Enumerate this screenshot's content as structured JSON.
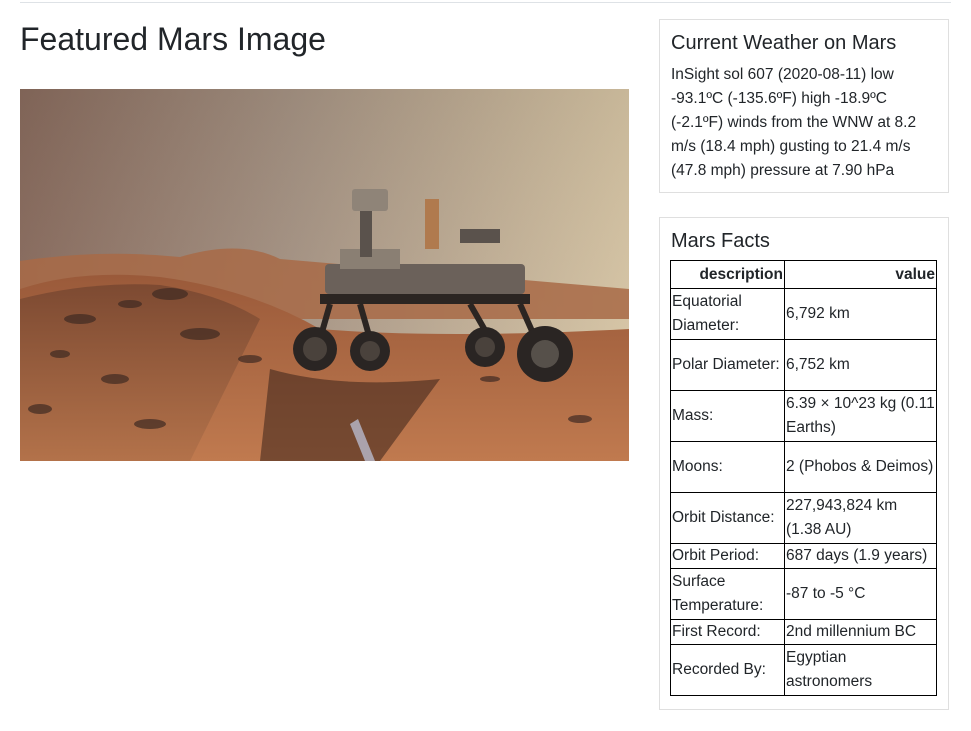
{
  "featured": {
    "title": "Featured Mars Image",
    "image_alt": "Mars rover selfie"
  },
  "weather": {
    "title": "Current Weather on Mars",
    "text": "InSight sol 607 (2020-08-11) low -93.1ºC (-135.6ºF) high -18.9ºC (-2.1ºF) winds from the WNW at 8.2 m/s (18.4 mph) gusting to 21.4 m/s (47.8 mph) pressure at 7.90 hPa"
  },
  "facts": {
    "title": "Mars Facts",
    "headers": [
      "description",
      "value"
    ],
    "rows": [
      {
        "description": "Equatorial Diameter:",
        "value": "6,792 km"
      },
      {
        "description": "Polar Diameter:",
        "value": "6,752 km"
      },
      {
        "description": "Mass:",
        "value": "6.39 × 10^23 kg (0.11 Earths)"
      },
      {
        "description": "Moons:",
        "value": "2 (Phobos & Deimos)"
      },
      {
        "description": "Orbit Distance:",
        "value": "227,943,824 km (1.38 AU)"
      },
      {
        "description": "Orbit Period:",
        "value": "687 days (1.9 years)"
      },
      {
        "description": "Surface Temperature:",
        "value": "-87 to -5 °C"
      },
      {
        "description": "First Record:",
        "value": "2nd millennium BC"
      },
      {
        "description": "Recorded By:",
        "value": "Egyptian astronomers"
      }
    ]
  },
  "colors": {
    "text": "#212529",
    "card_border": "#dfdfdf",
    "table_border": "#000000",
    "sky_left": "#8f7464",
    "sky_right": "#d8c6a6",
    "ground": "#a8633c"
  }
}
